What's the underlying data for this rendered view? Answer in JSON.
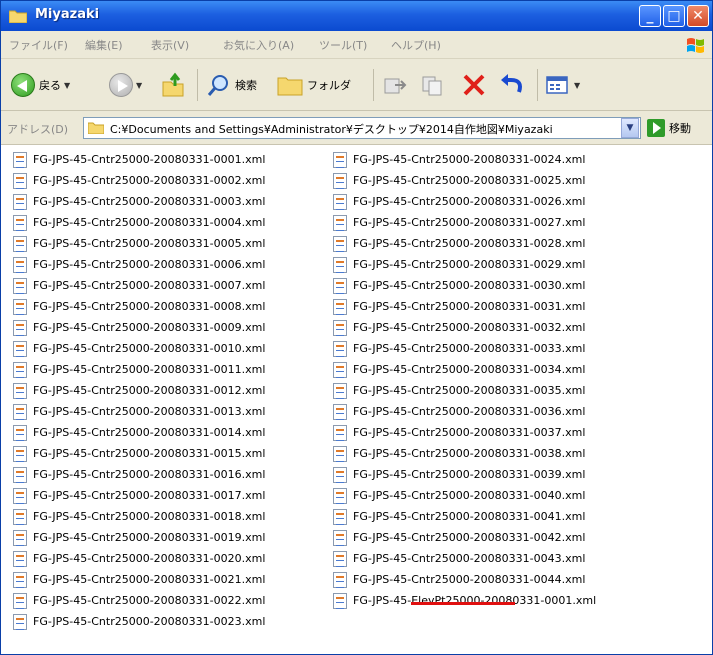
{
  "window": {
    "title": "Miyazaki"
  },
  "menu": [
    "ファイル(F)",
    "編集(E)",
    "表示(V)",
    "お気に入り(A)",
    "ツール(T)",
    "ヘルプ(H)"
  ],
  "toolbar": {
    "back_label": "戻る",
    "search_label": "検索",
    "folders_label": "フォルダ"
  },
  "address": {
    "label": "アドレス(D)",
    "path": "C:¥Documents and Settings¥Administrator¥デスクトップ¥2014自作地図¥Miyazaki",
    "go_label": "移動"
  },
  "files": {
    "column1": [
      "FG-JPS-45-Cntr25000-20080331-0001.xml",
      "FG-JPS-45-Cntr25000-20080331-0002.xml",
      "FG-JPS-45-Cntr25000-20080331-0003.xml",
      "FG-JPS-45-Cntr25000-20080331-0004.xml",
      "FG-JPS-45-Cntr25000-20080331-0005.xml",
      "FG-JPS-45-Cntr25000-20080331-0006.xml",
      "FG-JPS-45-Cntr25000-20080331-0007.xml",
      "FG-JPS-45-Cntr25000-20080331-0008.xml",
      "FG-JPS-45-Cntr25000-20080331-0009.xml",
      "FG-JPS-45-Cntr25000-20080331-0010.xml",
      "FG-JPS-45-Cntr25000-20080331-0011.xml",
      "FG-JPS-45-Cntr25000-20080331-0012.xml",
      "FG-JPS-45-Cntr25000-20080331-0013.xml",
      "FG-JPS-45-Cntr25000-20080331-0014.xml",
      "FG-JPS-45-Cntr25000-20080331-0015.xml",
      "FG-JPS-45-Cntr25000-20080331-0016.xml",
      "FG-JPS-45-Cntr25000-20080331-0017.xml",
      "FG-JPS-45-Cntr25000-20080331-0018.xml",
      "FG-JPS-45-Cntr25000-20080331-0019.xml",
      "FG-JPS-45-Cntr25000-20080331-0020.xml",
      "FG-JPS-45-Cntr25000-20080331-0021.xml",
      "FG-JPS-45-Cntr25000-20080331-0022.xml",
      "FG-JPS-45-Cntr25000-20080331-0023.xml"
    ],
    "column2": [
      "FG-JPS-45-Cntr25000-20080331-0024.xml",
      "FG-JPS-45-Cntr25000-20080331-0025.xml",
      "FG-JPS-45-Cntr25000-20080331-0026.xml",
      "FG-JPS-45-Cntr25000-20080331-0027.xml",
      "FG-JPS-45-Cntr25000-20080331-0028.xml",
      "FG-JPS-45-Cntr25000-20080331-0029.xml",
      "FG-JPS-45-Cntr25000-20080331-0030.xml",
      "FG-JPS-45-Cntr25000-20080331-0031.xml",
      "FG-JPS-45-Cntr25000-20080331-0032.xml",
      "FG-JPS-45-Cntr25000-20080331-0033.xml",
      "FG-JPS-45-Cntr25000-20080331-0034.xml",
      "FG-JPS-45-Cntr25000-20080331-0035.xml",
      "FG-JPS-45-Cntr25000-20080331-0036.xml",
      "FG-JPS-45-Cntr25000-20080331-0037.xml",
      "FG-JPS-45-Cntr25000-20080331-0038.xml",
      "FG-JPS-45-Cntr25000-20080331-0039.xml",
      "FG-JPS-45-Cntr25000-20080331-0040.xml",
      "FG-JPS-45-Cntr25000-20080331-0041.xml",
      "FG-JPS-45-Cntr25000-20080331-0042.xml",
      "FG-JPS-45-Cntr25000-20080331-0043.xml",
      "FG-JPS-45-Cntr25000-20080331-0044.xml",
      "FG-JPS-45-ElevPt25000-20080331-0001.xml"
    ]
  },
  "colors": {
    "titlebar": "#1c5fe0",
    "chrome": "#ece9d8",
    "highlight_underline": "#e01010"
  }
}
